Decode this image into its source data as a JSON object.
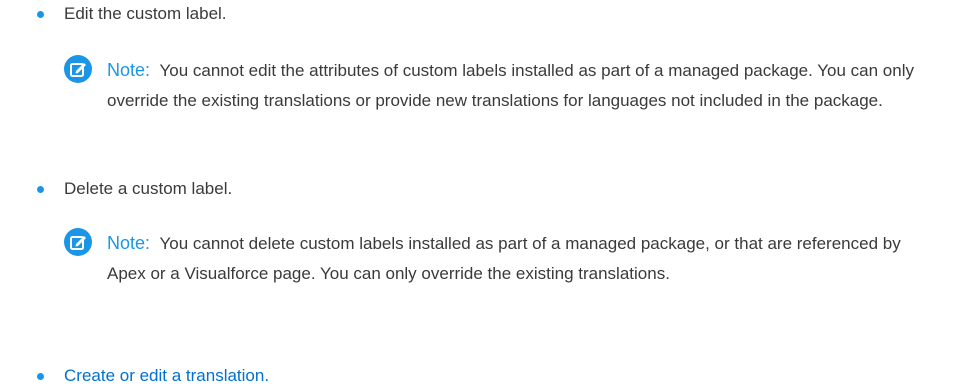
{
  "items": [
    {
      "text": "Edit the custom label.",
      "note": {
        "label": "Note:",
        "text": "You cannot edit the attributes of custom labels installed as part of a managed package. You can only override the existing translations or provide new translations for languages not included in the package."
      }
    },
    {
      "text": "Delete a custom label.",
      "note": {
        "label": "Note:",
        "text": "You cannot delete custom labels installed as part of a managed package, or that are referenced by Apex or a Visualforce page. You can only override the existing translations."
      }
    },
    {
      "text": "Create or edit a translation."
    }
  ],
  "icons": {
    "note": "note-edit-icon"
  },
  "colors": {
    "bullet": "#1b96e6",
    "note_label": "#1b96e6",
    "link": "#0070d2",
    "body_text": "#3a3a3a"
  }
}
